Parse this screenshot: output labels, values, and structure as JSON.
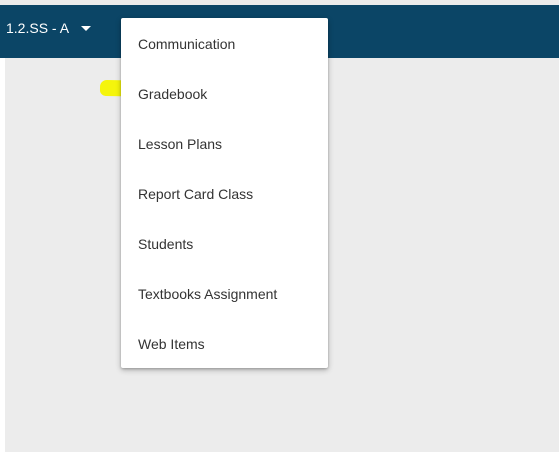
{
  "header": {
    "class_selector_label": "1.2.SS - A",
    "caret_icon": "caret-down-icon"
  },
  "menu": {
    "items": [
      {
        "label": "Communication"
      },
      {
        "label": "Gradebook"
      },
      {
        "label": "Lesson Plans"
      },
      {
        "label": "Report Card Class"
      },
      {
        "label": "Students"
      },
      {
        "label": "Textbooks Assignment"
      },
      {
        "label": "Web Items"
      }
    ],
    "highlighted_item": "Gradebook"
  },
  "colors": {
    "header_background": "#0b4566",
    "page_background": "#ececec",
    "menu_background": "#ffffff",
    "highlighter": "#f5f500"
  }
}
